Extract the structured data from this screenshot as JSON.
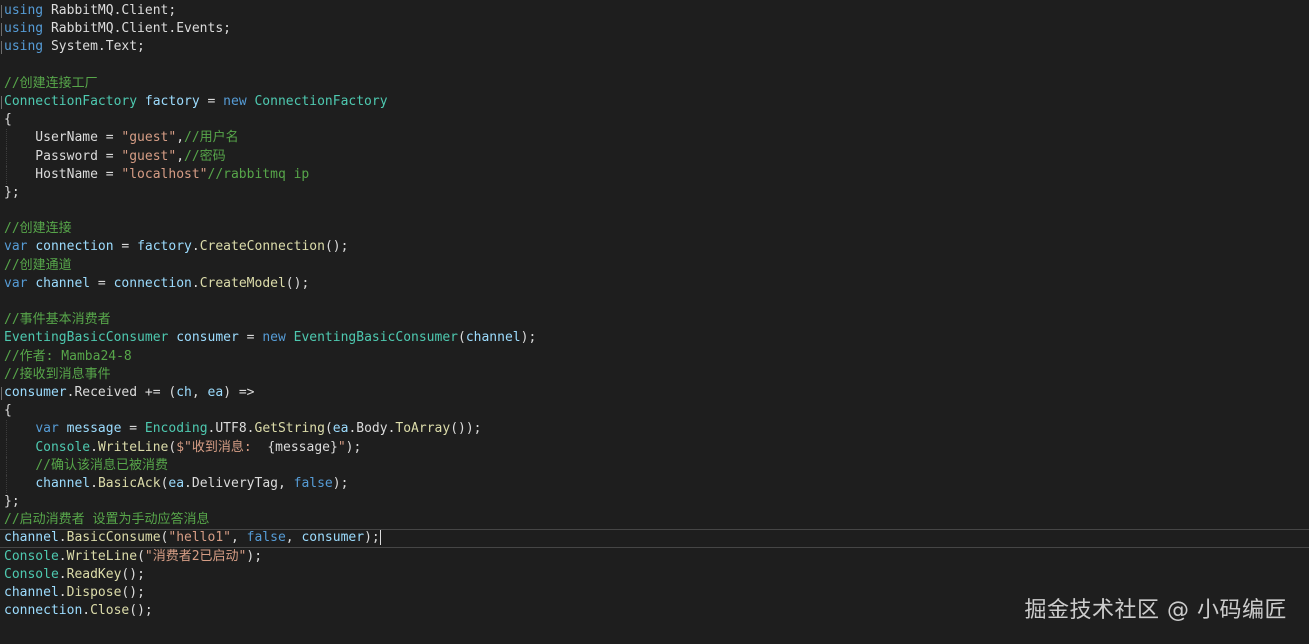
{
  "editor": {
    "lines": [
      [
        {
          "t": "using",
          "c": "kw"
        },
        {
          "t": " RabbitMQ.Client;",
          "c": "plain"
        }
      ],
      [
        {
          "t": "using",
          "c": "kw"
        },
        {
          "t": " RabbitMQ.Client.Events;",
          "c": "plain"
        }
      ],
      [
        {
          "t": "using",
          "c": "kw"
        },
        {
          "t": " System.Text;",
          "c": "plain"
        }
      ],
      [],
      [
        {
          "t": "//创建连接工厂",
          "c": "cm"
        }
      ],
      [
        {
          "t": "ConnectionFactory",
          "c": "type"
        },
        {
          "t": " ",
          "c": "plain"
        },
        {
          "t": "factory",
          "c": "id"
        },
        {
          "t": " = ",
          "c": "plain"
        },
        {
          "t": "new",
          "c": "kw"
        },
        {
          "t": " ",
          "c": "plain"
        },
        {
          "t": "ConnectionFactory",
          "c": "type"
        }
      ],
      [
        {
          "t": "{",
          "c": "plain"
        }
      ],
      [
        {
          "t": "    UserName = ",
          "c": "plain"
        },
        {
          "t": "\"guest\"",
          "c": "str"
        },
        {
          "t": ",",
          "c": "plain"
        },
        {
          "t": "//用户名",
          "c": "cm"
        }
      ],
      [
        {
          "t": "    Password = ",
          "c": "plain"
        },
        {
          "t": "\"guest\"",
          "c": "str"
        },
        {
          "t": ",",
          "c": "plain"
        },
        {
          "t": "//密码",
          "c": "cm"
        }
      ],
      [
        {
          "t": "    HostName = ",
          "c": "plain"
        },
        {
          "t": "\"localhost\"",
          "c": "str"
        },
        {
          "t": "//rabbitmq ip",
          "c": "cm"
        }
      ],
      [
        {
          "t": "};",
          "c": "plain"
        }
      ],
      [],
      [
        {
          "t": "//创建连接",
          "c": "cm"
        }
      ],
      [
        {
          "t": "var",
          "c": "kw"
        },
        {
          "t": " ",
          "c": "plain"
        },
        {
          "t": "connection",
          "c": "id"
        },
        {
          "t": " = ",
          "c": "plain"
        },
        {
          "t": "factory",
          "c": "id"
        },
        {
          "t": ".",
          "c": "plain"
        },
        {
          "t": "CreateConnection",
          "c": "fn"
        },
        {
          "t": "();",
          "c": "plain"
        }
      ],
      [
        {
          "t": "//创建通道",
          "c": "cm"
        }
      ],
      [
        {
          "t": "var",
          "c": "kw"
        },
        {
          "t": " ",
          "c": "plain"
        },
        {
          "t": "channel",
          "c": "id"
        },
        {
          "t": " = ",
          "c": "plain"
        },
        {
          "t": "connection",
          "c": "id"
        },
        {
          "t": ".",
          "c": "plain"
        },
        {
          "t": "CreateModel",
          "c": "fn"
        },
        {
          "t": "();",
          "c": "plain"
        }
      ],
      [],
      [
        {
          "t": "//事件基本消费者",
          "c": "cm"
        }
      ],
      [
        {
          "t": "EventingBasicConsumer",
          "c": "type"
        },
        {
          "t": " ",
          "c": "plain"
        },
        {
          "t": "consumer",
          "c": "id"
        },
        {
          "t": " = ",
          "c": "plain"
        },
        {
          "t": "new",
          "c": "kw"
        },
        {
          "t": " ",
          "c": "plain"
        },
        {
          "t": "EventingBasicConsumer",
          "c": "type"
        },
        {
          "t": "(",
          "c": "plain"
        },
        {
          "t": "channel",
          "c": "id"
        },
        {
          "t": ");",
          "c": "plain"
        }
      ],
      [
        {
          "t": "//作者: Mamba24-8",
          "c": "cm"
        }
      ],
      [
        {
          "t": "//接收到消息事件",
          "c": "cm"
        }
      ],
      [
        {
          "t": "consumer",
          "c": "id"
        },
        {
          "t": ".",
          "c": "plain"
        },
        {
          "t": "Received",
          "c": "plain"
        },
        {
          "t": " += (",
          "c": "plain"
        },
        {
          "t": "ch",
          "c": "id"
        },
        {
          "t": ", ",
          "c": "plain"
        },
        {
          "t": "ea",
          "c": "id"
        },
        {
          "t": ") =>",
          "c": "plain"
        }
      ],
      [
        {
          "t": "{",
          "c": "plain"
        }
      ],
      [
        {
          "t": "    ",
          "c": "plain"
        },
        {
          "t": "var",
          "c": "kw"
        },
        {
          "t": " ",
          "c": "plain"
        },
        {
          "t": "message",
          "c": "id"
        },
        {
          "t": " = ",
          "c": "plain"
        },
        {
          "t": "Encoding",
          "c": "type"
        },
        {
          "t": ".UTF8.",
          "c": "plain"
        },
        {
          "t": "GetString",
          "c": "fn"
        },
        {
          "t": "(",
          "c": "plain"
        },
        {
          "t": "ea",
          "c": "id"
        },
        {
          "t": ".Body.",
          "c": "plain"
        },
        {
          "t": "ToArray",
          "c": "fn"
        },
        {
          "t": "());",
          "c": "plain"
        }
      ],
      [
        {
          "t": "    ",
          "c": "plain"
        },
        {
          "t": "Console",
          "c": "type"
        },
        {
          "t": ".",
          "c": "plain"
        },
        {
          "t": "WriteLine",
          "c": "fn"
        },
        {
          "t": "(",
          "c": "plain"
        },
        {
          "t": "$\"收到消息:  ",
          "c": "str"
        },
        {
          "t": "{message}",
          "c": "interp"
        },
        {
          "t": "\"",
          "c": "str"
        },
        {
          "t": ");",
          "c": "plain"
        }
      ],
      [
        {
          "t": "    ",
          "c": "plain"
        },
        {
          "t": "//确认该消息已被消费",
          "c": "cm"
        }
      ],
      [
        {
          "t": "    ",
          "c": "plain"
        },
        {
          "t": "channel",
          "c": "id"
        },
        {
          "t": ".",
          "c": "plain"
        },
        {
          "t": "BasicAck",
          "c": "fn"
        },
        {
          "t": "(",
          "c": "plain"
        },
        {
          "t": "ea",
          "c": "id"
        },
        {
          "t": ".DeliveryTag, ",
          "c": "plain"
        },
        {
          "t": "false",
          "c": "kw"
        },
        {
          "t": ");",
          "c": "plain"
        }
      ],
      [
        {
          "t": "};",
          "c": "plain"
        }
      ],
      [
        {
          "t": "//启动消费者 设置为手动应答消息",
          "c": "cm"
        }
      ],
      [
        {
          "t": "channel",
          "c": "id"
        },
        {
          "t": ".",
          "c": "plain"
        },
        {
          "t": "BasicConsume",
          "c": "fn"
        },
        {
          "t": "(",
          "c": "plain"
        },
        {
          "t": "\"hello1\"",
          "c": "str"
        },
        {
          "t": ", ",
          "c": "plain"
        },
        {
          "t": "false",
          "c": "kw"
        },
        {
          "t": ", ",
          "c": "plain"
        },
        {
          "t": "consumer",
          "c": "id"
        },
        {
          "t": ");",
          "c": "plain"
        }
      ],
      [
        {
          "t": "Console",
          "c": "type"
        },
        {
          "t": ".",
          "c": "plain"
        },
        {
          "t": "WriteLine",
          "c": "fn"
        },
        {
          "t": "(",
          "c": "plain"
        },
        {
          "t": "\"消费者2已启动\"",
          "c": "str"
        },
        {
          "t": ");",
          "c": "plain"
        }
      ],
      [
        {
          "t": "Console",
          "c": "type"
        },
        {
          "t": ".",
          "c": "plain"
        },
        {
          "t": "ReadKey",
          "c": "fn"
        },
        {
          "t": "();",
          "c": "plain"
        }
      ],
      [
        {
          "t": "channel",
          "c": "id"
        },
        {
          "t": ".",
          "c": "plain"
        },
        {
          "t": "Dispose",
          "c": "fn"
        },
        {
          "t": "();",
          "c": "plain"
        }
      ],
      [
        {
          "t": "connection",
          "c": "id"
        },
        {
          "t": ".",
          "c": "plain"
        },
        {
          "t": "Close",
          "c": "fn"
        },
        {
          "t": "();",
          "c": "plain"
        }
      ]
    ],
    "current_line": 29,
    "guide_lines": [
      7,
      8,
      9,
      23,
      24,
      25,
      26
    ],
    "margin_marks": [
      0,
      1,
      2,
      5,
      21
    ]
  },
  "watermark": {
    "text": "掘金技术社区 @ 小码编匠"
  },
  "colors": {
    "background": "#1e1e1e",
    "keyword": "#569cd6",
    "type": "#4ec9b0",
    "string": "#d69d85",
    "comment": "#57a64a",
    "identifier": "#9cdcfe",
    "method": "#dcdcaa",
    "plain": "#dcdcdc"
  }
}
